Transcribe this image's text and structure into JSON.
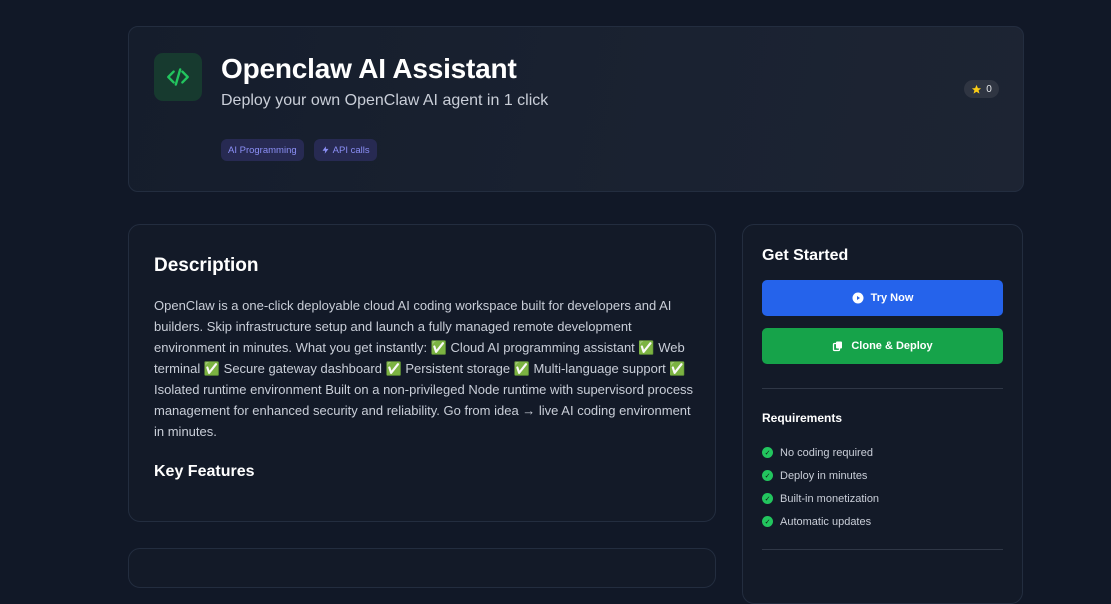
{
  "header": {
    "title": "Openclaw AI Assistant",
    "subtitle": "Deploy your own OpenClaw AI agent in 1 click",
    "tags": [
      {
        "label": "AI Programming",
        "icon": ""
      },
      {
        "label": "API calls",
        "icon": "lightning-icon"
      }
    ],
    "stars": "0",
    "accent_color": "#22c55e"
  },
  "description": {
    "heading": "Description",
    "text": "OpenClaw is a one-click deployable cloud AI coding workspace built for developers and AI builders. Skip infrastructure setup and launch a fully managed remote development environment in minutes. What you get instantly: ✅ Cloud AI programming assistant ✅ Web terminal ✅ Secure gateway dashboard ✅ Persistent storage ✅ Multi-language support ✅ Isolated runtime environment Built on a non-privileged Node runtime with supervisord process management for enhanced security and reliability. Go from idea → live AI coding environment in minutes.",
    "features_heading": "Key Features"
  },
  "sidebar": {
    "title": "Get Started",
    "try_label": "Try Now",
    "clone_label": "Clone & Deploy",
    "try_color": "#2563eb",
    "clone_color": "#16a34a",
    "requirements_title": "Requirements",
    "requirements": [
      "No coding required",
      "Deploy in minutes",
      "Built-in monetization",
      "Automatic updates"
    ]
  }
}
